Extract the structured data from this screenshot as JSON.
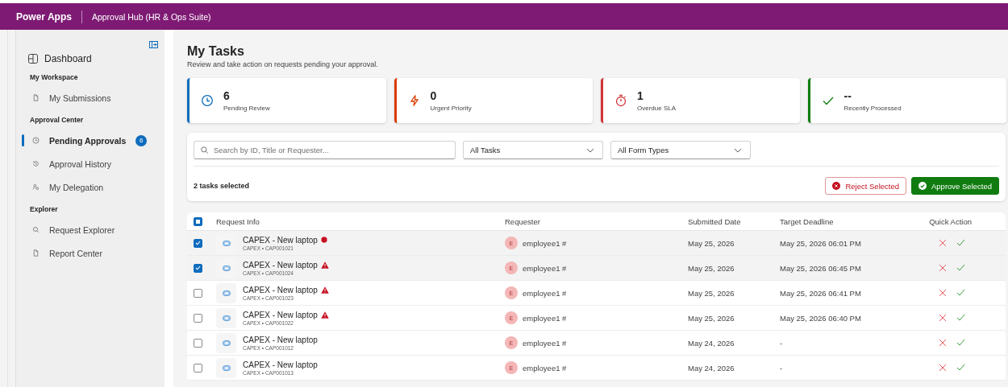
{
  "header": {
    "app": "Power Apps",
    "title": "Approval Hub (HR & Ops Suite)"
  },
  "sidebar": {
    "dashboard": "Dashboard",
    "sections": [
      {
        "title": "My Workspace",
        "items": [
          {
            "label": "My Submissions",
            "kind": "document",
            "selected": false
          }
        ]
      },
      {
        "title": "Approval Center",
        "items": [
          {
            "label": "Pending Approvals",
            "kind": "clock",
            "selected": true,
            "badge": "6"
          },
          {
            "label": "Approval History",
            "kind": "history",
            "selected": false
          },
          {
            "label": "My Delegation",
            "kind": "people",
            "selected": false
          }
        ]
      },
      {
        "title": "Explorer",
        "items": [
          {
            "label": "Request Explorer",
            "kind": "search",
            "selected": false
          },
          {
            "label": "Report Center",
            "kind": "document",
            "selected": false
          }
        ]
      }
    ]
  },
  "page": {
    "title": "My Tasks",
    "subtitle": "Review and take action on requests pending your approval."
  },
  "stats": [
    {
      "value": "6",
      "label": "Pending Review",
      "kind": "clock",
      "color": "#0f6cbd"
    },
    {
      "value": "0",
      "label": "Urgent Priority",
      "kind": "bolt",
      "color": "#da3b01"
    },
    {
      "value": "1",
      "label": "Overdue SLA",
      "kind": "timer",
      "color": "#d13438"
    },
    {
      "value": "--",
      "label": "Recently Processed",
      "kind": "check",
      "color": "#107c10"
    }
  ],
  "filters": {
    "search": {
      "placeholder": "Search by ID, Title or Requester..."
    },
    "task_filter": "All Tasks",
    "form_filter": "All Form Types"
  },
  "selection": {
    "text": "2 tasks selected",
    "reject": "Reject Selected",
    "approve": "Approve Selected"
  },
  "table": {
    "columns": [
      "Request Info",
      "Requester",
      "Submitted Date",
      "Target Deadline",
      "Quick Action"
    ],
    "partially_checked": true,
    "rows": [
      {
        "selected": true,
        "title": "CAPEX - New laptop",
        "kind": "critical",
        "subtitle": "CAPEX • CAP001021",
        "initial": "E",
        "requester": "employee1 #",
        "submitted": "May 25, 2026",
        "deadline": "May 25, 2026 06:01 PM"
      },
      {
        "selected": true,
        "title": "CAPEX - New laptop",
        "kind": "warning",
        "subtitle": "CAPEX • CAP001024",
        "initial": "E",
        "requester": "employee1 #",
        "submitted": "May 25, 2026",
        "deadline": "May 25, 2026 06:45 PM"
      },
      {
        "selected": false,
        "title": "CAPEX - New laptop",
        "kind": "warning",
        "subtitle": "CAPEX • CAP001023",
        "initial": "E",
        "requester": "employee1 #",
        "submitted": "May 25, 2026",
        "deadline": "May 25, 2026 06:41 PM"
      },
      {
        "selected": false,
        "title": "CAPEX - New laptop",
        "kind": "warning",
        "subtitle": "CAPEX • CAP001022",
        "initial": "E",
        "requester": "employee1 #",
        "submitted": "May 25, 2026",
        "deadline": "May 25, 2026 06:40 PM"
      },
      {
        "selected": false,
        "title": "CAPEX - New laptop",
        "kind": "normal",
        "subtitle": "CAPEX • CAP001012",
        "initial": "E",
        "requester": "employee1 #",
        "submitted": "May 24, 2026",
        "deadline": "-"
      },
      {
        "selected": false,
        "title": "CAPEX - New laptop",
        "kind": "normal",
        "subtitle": "CAPEX • CAP001013",
        "initial": "E",
        "requester": "employee1 #",
        "submitted": "May 24, 2026",
        "deadline": "-"
      }
    ]
  }
}
